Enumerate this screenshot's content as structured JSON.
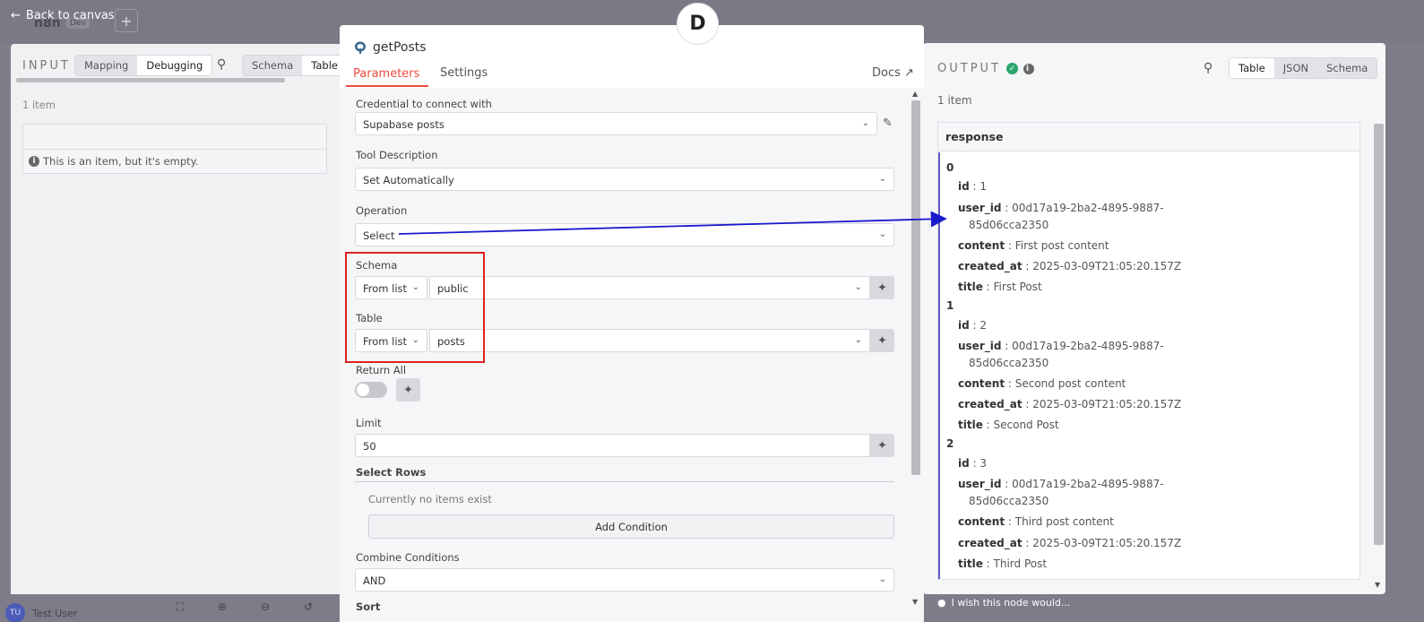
{
  "header": {
    "back_label": "Back to canvas",
    "plus_label": "+",
    "workflow_name": "n8n",
    "env_tag": "Dev"
  },
  "input_panel": {
    "title": "INPUT",
    "mode_tabs": [
      "Mapping",
      "Debugging"
    ],
    "active_mode": "Debugging",
    "view_tabs": [
      "Schema",
      "Table"
    ],
    "active_view": "Table",
    "item_count": "1 item",
    "empty_message": "This is an item, but it's empty."
  },
  "node": {
    "badge": "D",
    "title": "getPosts",
    "tabs": [
      "Parameters",
      "Settings"
    ],
    "active_tab": "Parameters",
    "docs_label": "Docs",
    "params": {
      "credential_label": "Credential to connect with",
      "credential_value": "Supabase posts",
      "tool_desc_label": "Tool Description",
      "tool_desc_value": "Set Automatically",
      "operation_label": "Operation",
      "operation_value": "Select",
      "schema_label": "Schema",
      "schema_mode": "From list",
      "schema_value": "public",
      "table_label": "Table",
      "table_mode": "From list",
      "table_value": "posts",
      "return_all_label": "Return All",
      "return_all": false,
      "limit_label": "Limit",
      "limit_value": "50",
      "select_rows_label": "Select Rows",
      "no_items": "Currently no items exist",
      "add_condition": "Add Condition",
      "combine_label": "Combine Conditions",
      "combine_value": "AND",
      "sort_label": "Sort"
    }
  },
  "output_panel": {
    "title": "OUTPUT",
    "status": "success",
    "view_tabs": [
      "Table",
      "JSON",
      "Schema"
    ],
    "active_view": "Table",
    "item_count": "1 item",
    "column": "response",
    "rows": [
      {
        "index": "0",
        "id": "1",
        "user_id_1": "00d17a19-2ba2-4895-9887-",
        "user_id_2": "85d06cca2350",
        "content": "First post content",
        "created_at": "2025-03-09T21:05:20.157Z",
        "title": "First Post"
      },
      {
        "index": "1",
        "id": "2",
        "user_id_1": "00d17a19-2ba2-4895-9887-",
        "user_id_2": "85d06cca2350",
        "content": "Second post content",
        "created_at": "2025-03-09T21:05:20.157Z",
        "title": "Second Post"
      },
      {
        "index": "2",
        "id": "3",
        "user_id_1": "00d17a19-2ba2-4895-9887-",
        "user_id_2": "85d06cca2350",
        "content": "Third post content",
        "created_at": "2025-03-09T21:05:20.157Z",
        "title": "Third Post"
      }
    ],
    "keys": {
      "id": "id",
      "user_id": "user_id",
      "content": "content",
      "created_at": "created_at",
      "title": "title"
    },
    "feedback": "I wish this node would..."
  },
  "footer": {
    "avatar_initials": "TU",
    "user_name": "Test User"
  },
  "colors": {
    "accent": "#ea4b3e",
    "highlight_box": "#e02222",
    "arrow": "#1a1acc",
    "success": "#2aa56b"
  }
}
